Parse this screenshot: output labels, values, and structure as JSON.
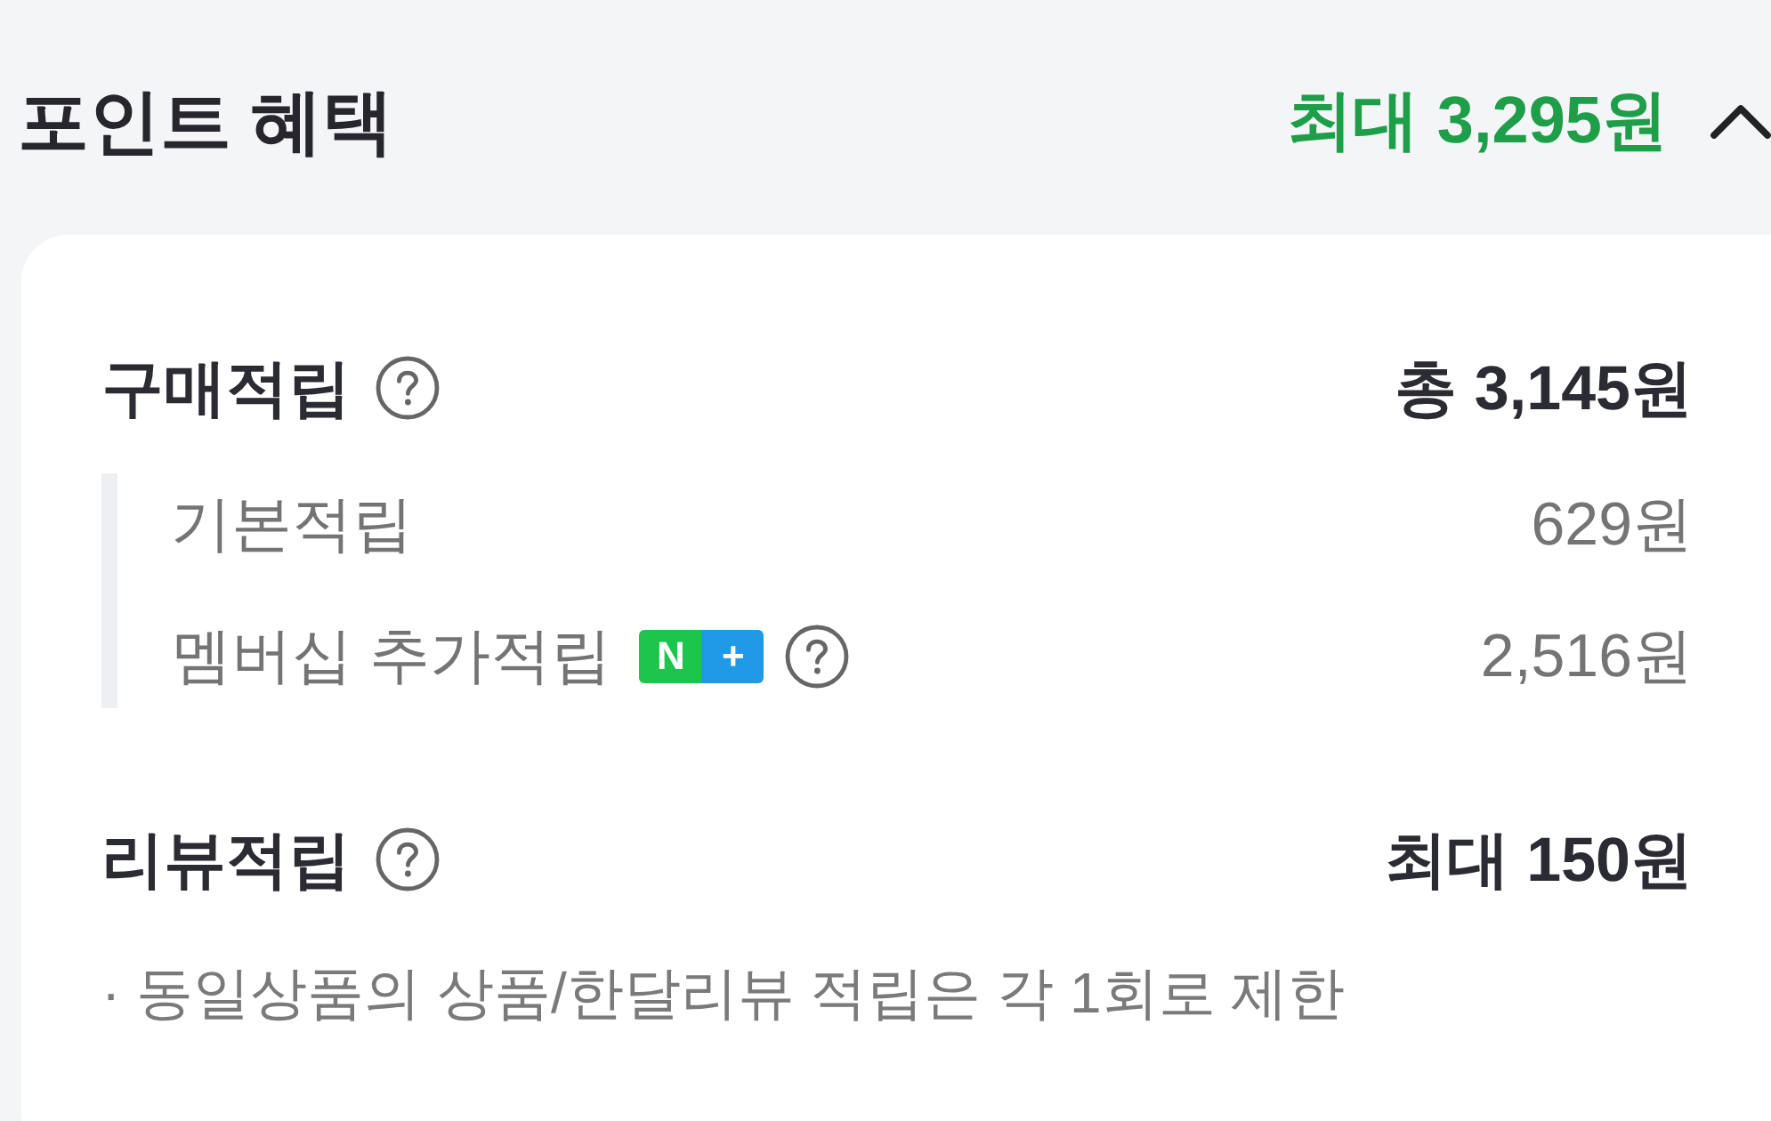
{
  "header": {
    "title": "포인트 혜택",
    "summary": "최대 3,295원",
    "expanded": true
  },
  "sections": [
    {
      "title": "구매적립",
      "help": true,
      "amount": "총 3,145원",
      "items": [
        {
          "label": "기본적립",
          "amount": "629원"
        },
        {
          "label": "멤버십 추가적립",
          "badge": [
            "N",
            "+"
          ],
          "help": true,
          "amount": "2,516원"
        }
      ]
    },
    {
      "title": "리뷰적립",
      "help": true,
      "amount": "최대 150원",
      "notes": [
        "· 동일상품의 상품/한달리뷰 적립은 각 1회로 제한"
      ]
    }
  ]
}
